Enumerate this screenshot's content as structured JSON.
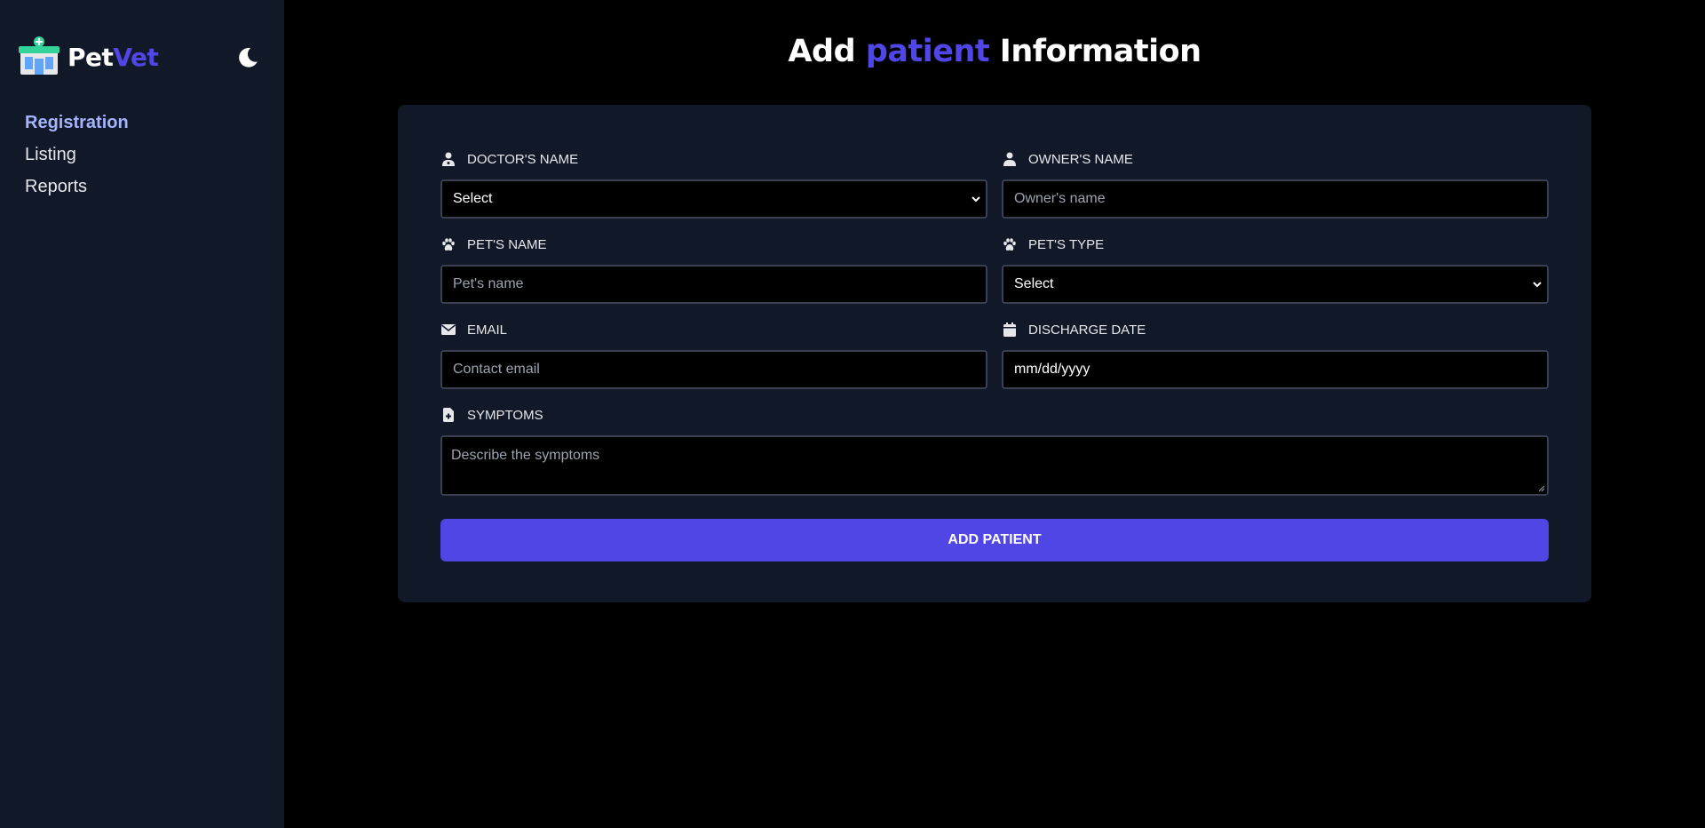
{
  "brand": {
    "name_part1": "Pet",
    "name_part2": "Vet",
    "logo_icon": "clinic-building-icon",
    "accent_color": "#4f46e5"
  },
  "theme_toggle": {
    "icon": "moon-icon"
  },
  "sidebar": {
    "items": [
      {
        "label": "Registration",
        "active": true
      },
      {
        "label": "Listing",
        "active": false
      },
      {
        "label": "Reports",
        "active": false
      }
    ]
  },
  "page": {
    "title_part1": "Add",
    "title_accent": "patient",
    "title_part2": "Information"
  },
  "form": {
    "doctor": {
      "label": "Doctor's name",
      "icon": "user-doctor-icon",
      "value": "Select"
    },
    "owner": {
      "label": "Owner's name",
      "icon": "user-icon",
      "placeholder": "Owner's name"
    },
    "pet_name": {
      "label": "Pet's name",
      "icon": "paw-icon",
      "placeholder": "Pet's name"
    },
    "pet_type": {
      "label": "Pet's type",
      "icon": "paw-icon",
      "value": "Select"
    },
    "email": {
      "label": "Email",
      "icon": "envelope-icon",
      "placeholder": "Contact email"
    },
    "discharge_date": {
      "label": "Discharge date",
      "icon": "calendar-icon",
      "value": "mm/dd/yyyy"
    },
    "symptoms": {
      "label": "Symptoms",
      "icon": "file-medical-icon",
      "placeholder": "Describe the symptoms"
    },
    "submit_label": "ADD PATIENT"
  }
}
